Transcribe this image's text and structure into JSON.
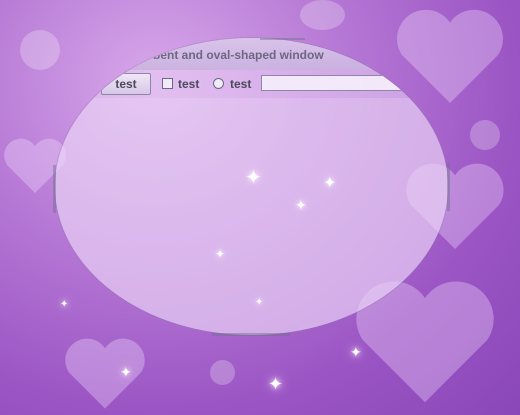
{
  "window": {
    "title": "bent and oval-shaped window",
    "shape": "oval",
    "translucent": true
  },
  "toolbar": {
    "button_label": "test",
    "checkbox_label": "test",
    "checkbox_checked": false,
    "radio_label": "test",
    "radio_selected": false,
    "text_field_value": ""
  },
  "background": {
    "theme": "purple hearts and sparkles wallpaper",
    "colors": [
      "#d8a8ea",
      "#b77ad6",
      "#9b55c4",
      "#8a47b8"
    ]
  }
}
